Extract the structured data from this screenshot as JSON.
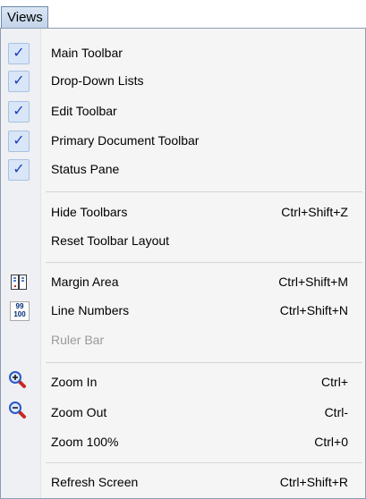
{
  "menu": {
    "title": "Views"
  },
  "groups": [
    {
      "items": [
        {
          "label": "Main Toolbar",
          "checked": true
        },
        {
          "label": "Drop-Down Lists",
          "checked": true
        },
        {
          "label": "Edit Toolbar",
          "checked": true
        },
        {
          "label": "Primary Document Toolbar",
          "checked": true
        },
        {
          "label": "Status Pane",
          "checked": true
        }
      ]
    },
    {
      "items": [
        {
          "label": "Hide Toolbars",
          "shortcut": "Ctrl+Shift+Z"
        },
        {
          "label": "Reset Toolbar Layout",
          "shortcut": ""
        }
      ]
    },
    {
      "items": [
        {
          "label": "Margin Area",
          "shortcut": "Ctrl+Shift+M",
          "icon": "margin-area-icon"
        },
        {
          "label": "Line Numbers",
          "shortcut": "Ctrl+Shift+N",
          "icon": "line-numbers-icon"
        },
        {
          "label": "Ruler Bar",
          "shortcut": "",
          "disabled": true
        }
      ]
    },
    {
      "items": [
        {
          "label": "Zoom In",
          "shortcut": "Ctrl+",
          "icon": "zoom-in-icon"
        },
        {
          "label": "Zoom Out",
          "shortcut": "Ctrl-",
          "icon": "zoom-out-icon"
        },
        {
          "label": "Zoom 100%",
          "shortcut": "Ctrl+0"
        }
      ]
    },
    {
      "items": [
        {
          "label": "Refresh Screen",
          "shortcut": "Ctrl+Shift+R"
        }
      ]
    }
  ],
  "icons": {
    "check_glyph": "✓",
    "line_numbers_top": "99",
    "line_numbers_bottom": "100"
  },
  "colors": {
    "check": "#1a3fbf",
    "zoom_lens": "#2a57c9",
    "zoom_handle": "#c8281e"
  }
}
